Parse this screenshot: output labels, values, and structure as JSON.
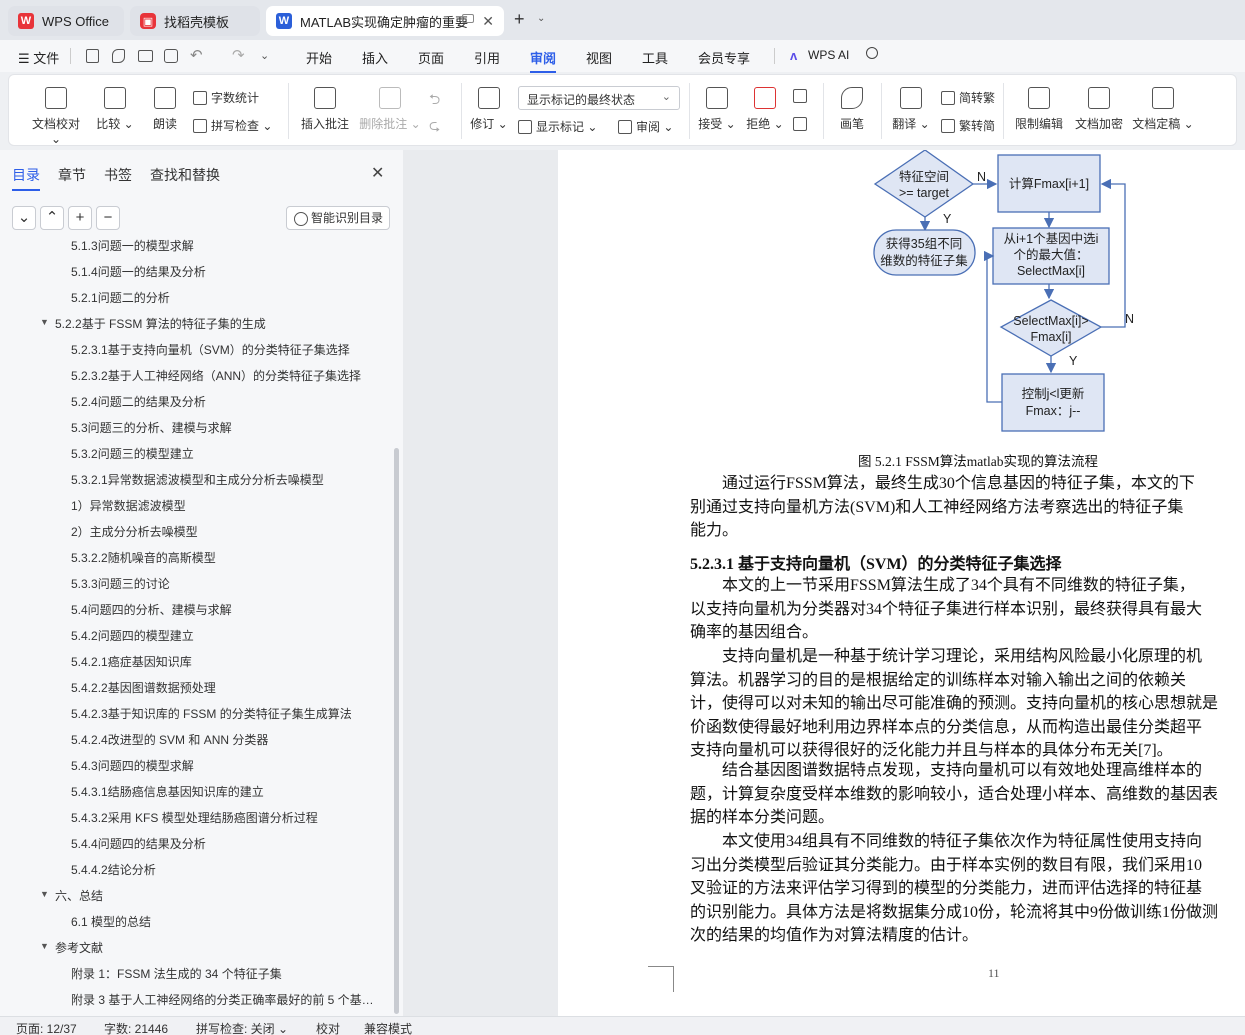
{
  "tabs": [
    {
      "label": "WPS Office"
    },
    {
      "label": "找稻壳模板"
    },
    {
      "label": "MATLAB实现确定肿瘤的重要"
    }
  ],
  "menu": {
    "file": "文件",
    "items": [
      "开始",
      "插入",
      "页面",
      "引用",
      "审阅",
      "视图",
      "工具",
      "会员专享"
    ],
    "active": "审阅",
    "wps_ai": "WPS AI"
  },
  "ribbon": {
    "doc_check": "文档校对",
    "compare": "比较",
    "read_aloud": "朗读",
    "word_count": "字数统计",
    "spell_check": "拼写检查",
    "insert_comment": "插入批注",
    "delete_comment": "删除批注",
    "revise": "修订",
    "markup_state": "显示标记的最终状态",
    "show_markup": "显示标记",
    "review": "审阅",
    "accept": "接受",
    "reject": "拒绝",
    "pen": "画笔",
    "translate": "翻译",
    "to_traditional": "简转繁",
    "to_simplified": "繁转简",
    "restrict_edit": "限制编辑",
    "encrypt": "文档加密",
    "finalize": "文档定稿"
  },
  "panel": {
    "tabs": [
      "目录",
      "章节",
      "书签",
      "查找和替换"
    ],
    "active_tab": "目录",
    "ai_toc": "智能识别目录",
    "toc": [
      {
        "text": "5.1.3问题一的模型求解",
        "level": 3
      },
      {
        "text": "5.1.4问题一的结果及分析",
        "level": 3
      },
      {
        "text": "5.2.1问题二的分析",
        "level": 3
      },
      {
        "text": "5.2.2基于 FSSM 算法的特征子集的生成",
        "level": 2,
        "expanded": true
      },
      {
        "text": "5.2.3.1基于支持向量机（SVM）的分类特征子集选择",
        "level": 3
      },
      {
        "text": "5.2.3.2基于人工神经网络（ANN）的分类特征子集选择",
        "level": 3
      },
      {
        "text": "5.2.4问题二的结果及分析",
        "level": 3
      },
      {
        "text": "5.3问题三的分析、建模与求解",
        "level": 3
      },
      {
        "text": "5.3.2问题三的模型建立",
        "level": 3
      },
      {
        "text": "5.3.2.1异常数据滤波模型和主成分分析去噪模型",
        "level": 3
      },
      {
        "text": "1）异常数据滤波模型",
        "level": 3
      },
      {
        "text": "2）主成分分析去噪模型",
        "level": 3
      },
      {
        "text": "5.3.2.2随机噪音的高斯模型",
        "level": 3
      },
      {
        "text": "5.3.3问题三的讨论",
        "level": 3
      },
      {
        "text": "5.4问题四的分析、建模与求解",
        "level": 3
      },
      {
        "text": "5.4.2问题四的模型建立",
        "level": 3
      },
      {
        "text": "5.4.2.1癌症基因知识库",
        "level": 3
      },
      {
        "text": "5.4.2.2基因图谱数据预处理",
        "level": 3
      },
      {
        "text": "5.4.2.3基于知识库的 FSSM 的分类特征子集生成算法",
        "level": 3
      },
      {
        "text": "5.4.2.4改进型的 SVM 和 ANN 分类器",
        "level": 3
      },
      {
        "text": "5.4.3问题四的模型求解",
        "level": 3
      },
      {
        "text": "5.4.3.1结肠癌信息基因知识库的建立",
        "level": 3
      },
      {
        "text": "5.4.3.2采用 KFS 模型处理结肠癌图谱分析过程",
        "level": 3
      },
      {
        "text": "5.4.4问题四的结果及分析",
        "level": 3
      },
      {
        "text": "5.4.4.2结论分析",
        "level": 3
      },
      {
        "text": "六、总结",
        "level": 2,
        "expanded": true
      },
      {
        "text": "6.1 模型的总结",
        "level": 3
      },
      {
        "text": "参考文献",
        "level": 2,
        "expanded": true
      },
      {
        "text": "附录 1：FSSM 法生成的 34 个特征子集",
        "level": 3
      },
      {
        "text": "附录 3 基于人工神经网络的分类正确率最好的前 5 个基…",
        "level": 3
      }
    ]
  },
  "flowchart": {
    "diamond1": [
      "特征空间",
      ">=  target"
    ],
    "n1": "N",
    "y1": "Y",
    "box1": "计算Fmax[i+1]",
    "terminal": [
      "获得35组不同",
      "维数的特征子集"
    ],
    "box2": [
      "从i+1个基因中选i",
      "个的最大值：",
      "SelectMax[i]"
    ],
    "diamond2": [
      "SelectMax[i]>",
      "Fmax[i]"
    ],
    "n2": "N",
    "y2": "Y",
    "box3": [
      "控制j<l更新",
      "Fmax：j--"
    ]
  },
  "document": {
    "caption": "图  5.2.1 FSSM算法matlab实现的算法流程",
    "para1": [
      "通过运行FSSM算法，最终生成30个信息基因的特征子集，本文的下",
      "别通过支持向量机方法(SVM)和人工神经网络方法考察选出的特征子集",
      "能力。"
    ],
    "heading": "5.2.3.1  基于支持向量机（SVM）的分类特征子集选择",
    "para2": [
      "本文的上一节采用FSSM算法生成了34个具有不同维数的特征子集，",
      "以支持向量机为分类器对34个特征子集进行样本识别，最终获得具有最大",
      "确率的基因组合。"
    ],
    "para3": [
      "支持向量机是一种基于统计学习理论，采用结构风险最小化原理的机",
      "算法。机器学习的目的是根据给定的训练样本对输入输出之间的依赖关",
      "计，使得可以对未知的输出尽可能准确的预测。支持向量机的核心思想就是",
      "价函数使得最好地利用边界样本点的分类信息，从而构造出最佳分类超平",
      "支持向量机可以获得很好的泛化能力并且与样本的具体分布无关[7]。"
    ],
    "para4": [
      "结合基因图谱数据特点发现，支持向量机可以有效地处理高维样本的",
      "题，计算复杂度受样本维数的影响较小，适合处理小样本、高维数的基因表",
      "据的样本分类问题。"
    ],
    "para5": [
      "本文使用34组具有不同维数的特征子集依次作为特征属性使用支持向",
      "习出分类模型后验证其分类能力。由于样本实例的数目有限，我们采用10",
      "叉验证的方法来评估学习得到的模型的分类能力，进而评估选择的特征基",
      "的识别能力。具体方法是将数据集分成10份，轮流将其中9份做训练1份做测",
      "次的结果的均值作为对算法精度的估计。"
    ],
    "page_number": "11"
  },
  "status": {
    "page": "页面: 12/37",
    "words": "字数: 21446",
    "spell": "拼写检查: 关闭",
    "proofread": "校对",
    "compat": "兼容模式"
  },
  "colors": {
    "accent": "#2d5ee8",
    "wps_red": "#e8343a",
    "word_blue": "#2b5fd9",
    "flow_fill": "#dfe6f4",
    "flow_stroke": "#4a6fb5"
  }
}
